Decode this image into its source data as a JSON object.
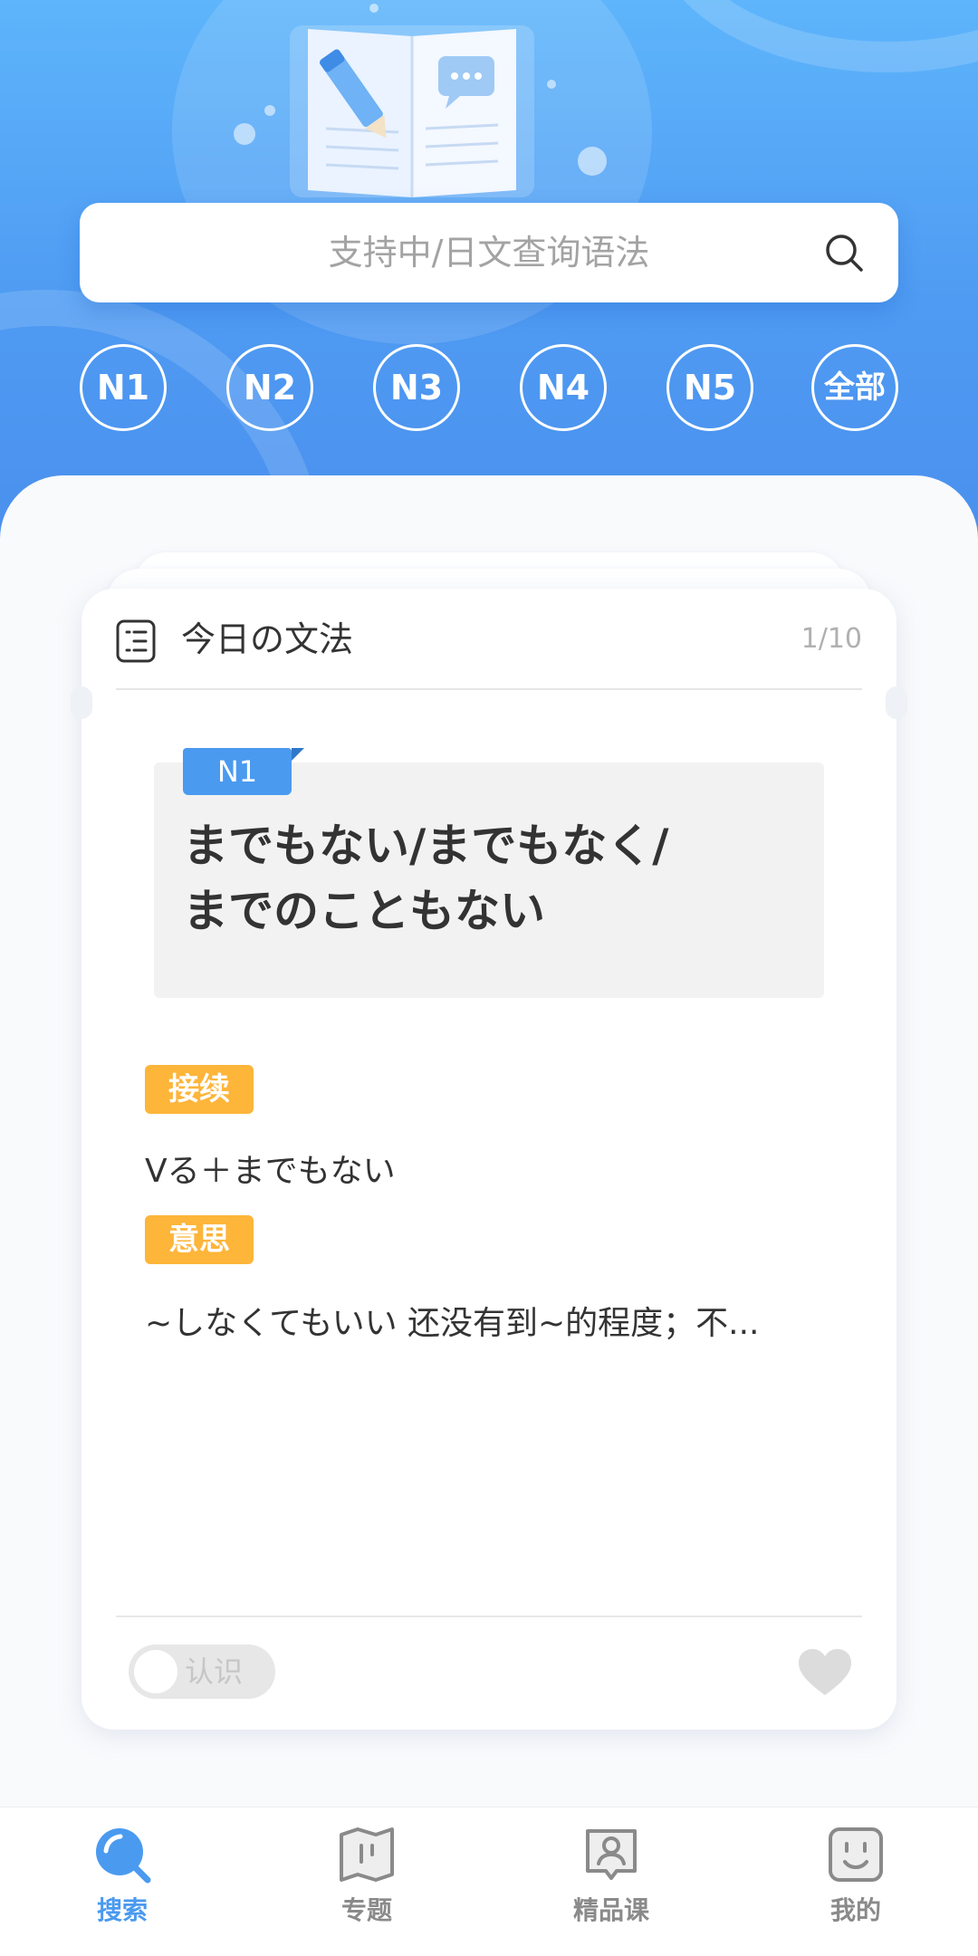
{
  "search": {
    "placeholder": "支持中/日文查询语法"
  },
  "levels": [
    "N1",
    "N2",
    "N3",
    "N4",
    "N5",
    "全部"
  ],
  "card": {
    "title": "今日の文法",
    "counter": "1/10",
    "level_tag": "N1",
    "grammar_lines": [
      "までもない/までもなく/",
      "までのこともない"
    ],
    "connection_label": "接续",
    "connection_text": "Vる＋までもない",
    "meaning_label": "意思",
    "meaning_text": "~しなくてもいい 还没有到~的程度；不...",
    "known_toggle_label": "认识",
    "known_toggle_on": false,
    "favorite": false
  },
  "nav": [
    {
      "label": "搜索",
      "icon": "search-icon",
      "active": true
    },
    {
      "label": "专题",
      "icon": "map-book-icon",
      "active": false
    },
    {
      "label": "精品课",
      "icon": "user-card-icon",
      "active": false
    },
    {
      "label": "我的",
      "icon": "smiley-icon",
      "active": false
    }
  ],
  "colors": {
    "header_top": "#5eb5fb",
    "header_bottom": "#4a90ee",
    "accent": "#4a9af0",
    "badge": "#fdb53a"
  }
}
